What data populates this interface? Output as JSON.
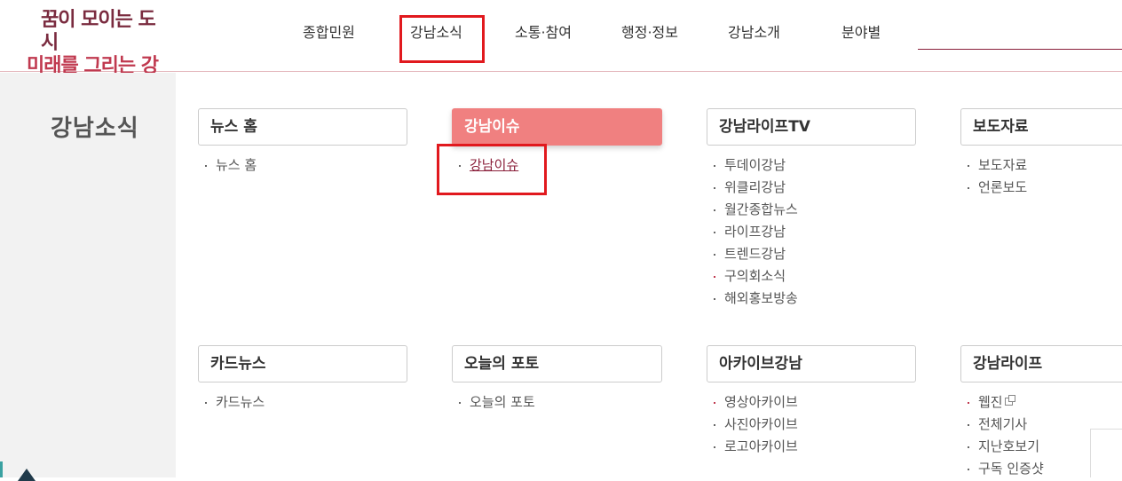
{
  "logo": {
    "line1": "꿈이 모이는 도시",
    "line2": "미래를 그리는 강남"
  },
  "nav": {
    "items": [
      "종합민원",
      "강남소식",
      "소통·참여",
      "행정·정보",
      "강남소개",
      "분야별"
    ]
  },
  "sidebar": {
    "title": "강남소식"
  },
  "cards": [
    {
      "title": "뉴스 홈",
      "items": [
        "뉴스 홈"
      ]
    },
    {
      "title": "강남이슈",
      "items": [
        "강남이슈"
      ]
    },
    {
      "title": "강남라이프TV",
      "items": [
        "투데이강남",
        "위클리강남",
        "월간종합뉴스",
        "라이프강남",
        "트렌드강남",
        "구의회소식",
        "해외홍보방송"
      ]
    },
    {
      "title": "보도자료",
      "items": [
        "보도자료",
        "언론보도"
      ]
    },
    {
      "title": "카드뉴스",
      "items": [
        "카드뉴스"
      ]
    },
    {
      "title": "오늘의 포토",
      "items": [
        "오늘의 포토"
      ]
    },
    {
      "title": "아카이브강남",
      "items": [
        "영상아카이브",
        "사진아카이브",
        "로고아카이브"
      ]
    },
    {
      "title": "강남라이프",
      "items": [
        "웹진",
        "전체기사",
        "지난호보기",
        "구독 인증샷"
      ]
    }
  ],
  "colors": {
    "active_card": "#f08080",
    "highlight_box": "#e1191e",
    "brand": "#8a1f3a"
  }
}
